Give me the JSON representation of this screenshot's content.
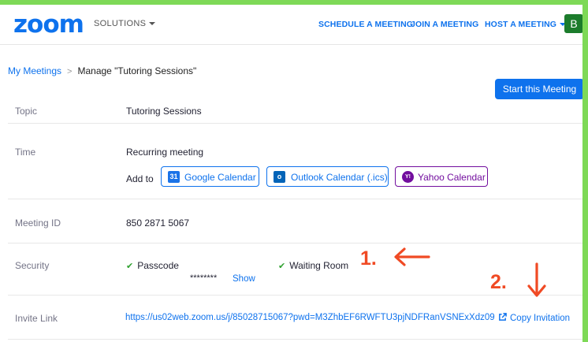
{
  "header": {
    "logo": "zoom",
    "solutions_label": "SOLUTIONS",
    "nav": {
      "schedule": "SCHEDULE A MEETING",
      "join": "JOIN A MEETING",
      "host": "HOST A MEETING"
    },
    "avatar_initial": "B"
  },
  "breadcrumb": {
    "parent": "My Meetings",
    "separator": ">",
    "current": "Manage \"Tutoring Sessions\""
  },
  "start_button": "Start this Meeting",
  "topic": {
    "label": "Topic",
    "value": "Tutoring Sessions"
  },
  "time": {
    "label": "Time",
    "value": "Recurring meeting",
    "add_to_label": "Add to",
    "calendars": {
      "google": {
        "icon_text": "31",
        "label": "Google Calendar"
      },
      "outlook": {
        "icon_text": "o",
        "label": "Outlook Calendar (.ics)"
      },
      "yahoo": {
        "icon_text": "Y!",
        "label": "Yahoo Calendar"
      }
    }
  },
  "meeting_id": {
    "label": "Meeting ID",
    "value": "850 2871 5067"
  },
  "security": {
    "label": "Security",
    "passcode_label": "Passcode",
    "passcode_masked": "********",
    "show_label": "Show",
    "waiting_room_label": "Waiting Room"
  },
  "invite": {
    "label": "Invite Link",
    "url": "https://us02web.zoom.us/j/85028715067?pwd=M3ZhbEF6RWFTU3pjNDFRanVSNExXdz09",
    "copy_label": "Copy Invitation"
  },
  "annotations": {
    "one": "1.",
    "two": "2."
  },
  "colors": {
    "brand_blue": "#0e72ed",
    "frame_green": "#7ed957",
    "annotation_red": "#f04a24",
    "avatar_green": "#1c7c2c",
    "yahoo_purple": "#720e9e",
    "check_green": "#2fa12f"
  },
  "icons": {
    "solutions": "chevron-down-icon",
    "host": "chevron-down-icon",
    "check": "check-icon",
    "copy": "external-link-icon",
    "arrow_one": "arrow-left-icon",
    "arrow_two": "arrow-down-icon"
  }
}
